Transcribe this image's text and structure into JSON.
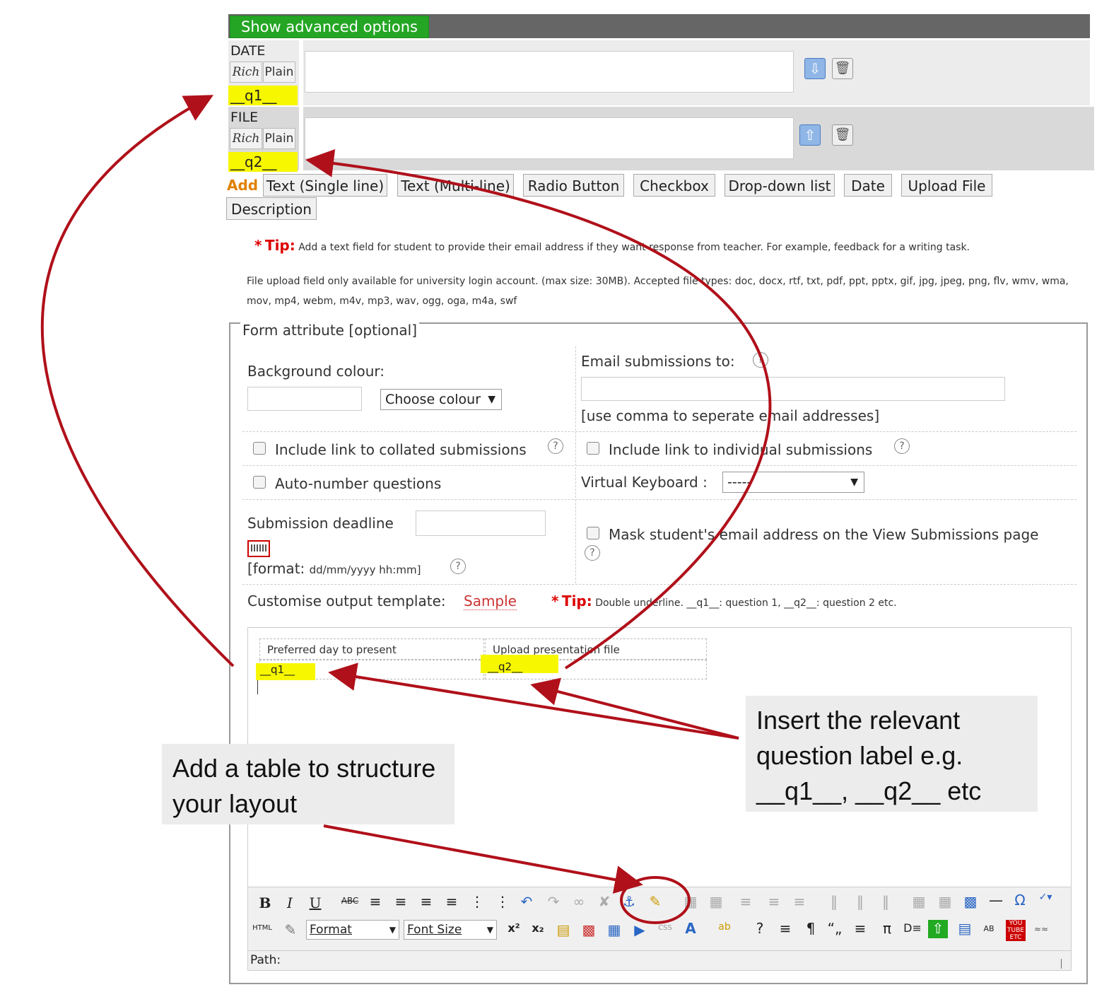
{
  "header": {
    "show_advanced_label": "Show advanced options"
  },
  "questions": [
    {
      "type": "DATE",
      "rich": "Rich",
      "plain": "Plain",
      "label": "__q1__",
      "move_icon": "arrow-down-icon"
    },
    {
      "type": "FILE",
      "rich": "Rich",
      "plain": "Plain",
      "label": "__q2__",
      "move_icon": "arrow-up-icon"
    }
  ],
  "add_bar": {
    "add_label": "Add",
    "buttons": [
      "Text (Single line)",
      "Text (Multi-line)",
      "Radio Button",
      "Checkbox",
      "Drop-down list",
      "Date",
      "Upload File",
      "Description"
    ]
  },
  "tip": {
    "star": "*",
    "label": "Tip:",
    "text": "Add a text field for student to provide their email address if they want response from teacher. For example, feedback for a writing task."
  },
  "file_info": "File upload field only available for university login account. (max size: 30MB). Accepted file types: doc, docx, rtf, txt, pdf, ppt, pptx, gif, jpg, jpeg, png, flv, wmv, wma, mov, mp4, webm, m4v, mp3, wav, ogg, oga, m4a, swf",
  "form_attr": {
    "legend": "Form attribute [optional]",
    "background_label": "Background colour:",
    "choose_colour": "Choose colour",
    "email_label": "Email submissions to:",
    "email_hint": "[use comma to seperate email addresses]",
    "collated_label": "Include link to collated submissions",
    "individual_label": "Include link to individual submissions",
    "autonumber_label": "Auto-number questions",
    "keyboard_label": "Virtual Keyboard :",
    "keyboard_value": "-----",
    "deadline_label": "Submission deadline",
    "format_prefix": "[format:",
    "format_value": "dd/mm/yyyy hh:mm]",
    "mask_label": "Mask student's email address on the View Submissions page",
    "template_label": "Customise output template:",
    "sample_link": "Sample",
    "tip_star": "*",
    "tip_label": "Tip:",
    "tip_text": "Double underline. __q1__: question 1, __q2__: question 2 etc."
  },
  "editor": {
    "headers": [
      "Preferred day to present",
      "Upload presentation file"
    ],
    "cells": [
      "__q1__",
      "__q2__"
    ],
    "format_select": "Format",
    "font_size_select": "Font Size",
    "path_label": "Path:",
    "html_label": "HTML"
  },
  "callouts": {
    "insert_label": "Insert the relevant question label e.g. __q1__, __q2__ etc",
    "add_table": "Add a table to structure your layout"
  },
  "colors": {
    "annotation_red": "#b0101a",
    "highlight": "#f7f700",
    "green_button": "#24a624",
    "add_orange": "#e08000"
  }
}
